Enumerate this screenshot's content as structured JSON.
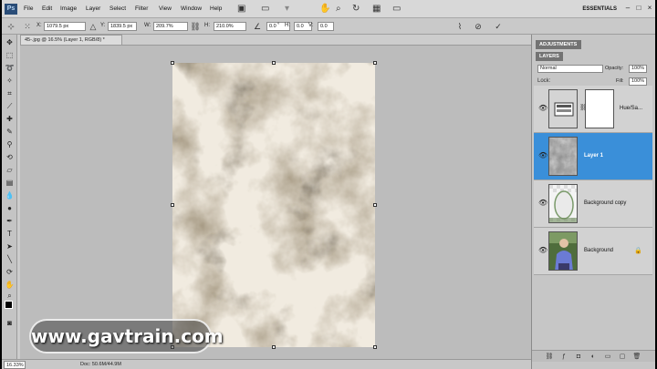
{
  "app": {
    "logo": "Ps",
    "menus": [
      "File",
      "Edit",
      "Image",
      "Layer",
      "Select",
      "Filter",
      "View",
      "Window",
      "Help"
    ],
    "workspace": "ESSENTIALS"
  },
  "options": {
    "x_value": "1079.5 px",
    "y_value": "1839.5 px",
    "w_label": "W:",
    "w_value": "209.7%",
    "h_label": "H:",
    "h_value": "210.0%",
    "angle_value": "0.0",
    "hskew_label": "H:",
    "hskew_value": "0.0",
    "vskew_label": "V:",
    "vskew_value": "0.0"
  },
  "document": {
    "tab_title": "45-.jpg @ 16.5% (Layer 1, RGB/8) *",
    "zoom": "16.33%",
    "info": "Doc: 50.6M/44.9M"
  },
  "watermark": "www.gavtrain.com",
  "panels": {
    "adjustments_tab": "ADJUSTMENTS",
    "layers_tab": "LAYERS",
    "blend_mode": "Normal",
    "opacity_label": "Opacity:",
    "opacity_value": "100%",
    "fill_label": "Fill:",
    "fill_value": "100%",
    "lock_label": "Lock:",
    "layers": [
      {
        "name": "Hue/Sa..."
      },
      {
        "name": "Layer 1"
      },
      {
        "name": "Background copy"
      },
      {
        "name": "Background"
      }
    ]
  },
  "colors": {
    "selection": "#3a8fd9",
    "toolbar_bg": "#c9c9c9",
    "canvas_base": "#a89c86"
  }
}
